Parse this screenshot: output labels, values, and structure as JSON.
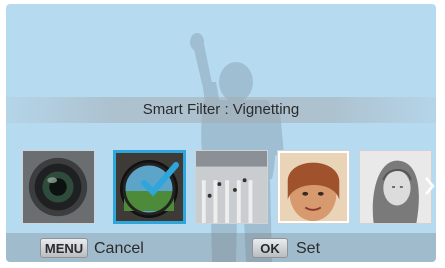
{
  "title": "Smart Filter : Vignetting",
  "filters": [
    {
      "name": "Lens filter",
      "selected": false
    },
    {
      "name": "Vignetting",
      "selected": true
    },
    {
      "name": "Miniature",
      "selected": false
    },
    {
      "name": "Portrait color",
      "selected": false
    },
    {
      "name": "Sketch",
      "selected": false
    }
  ],
  "controls": {
    "menu_key": "MENU",
    "menu_action": "Cancel",
    "ok_key": "OK",
    "ok_action": "Set"
  },
  "colors": {
    "background": "#b6dbf1",
    "selection": "#2ea6dc"
  }
}
